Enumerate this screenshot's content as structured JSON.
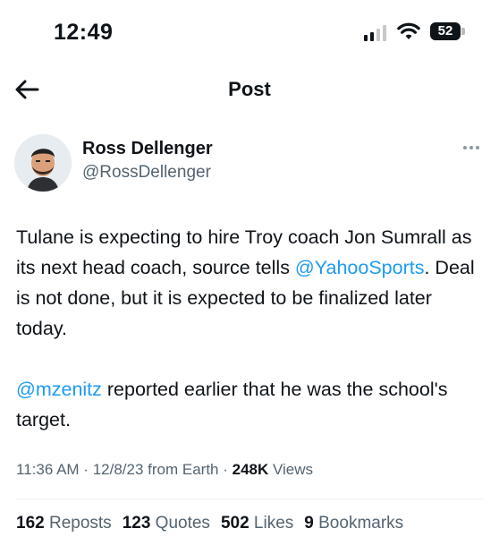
{
  "status_bar": {
    "time": "12:49",
    "battery_level": "52",
    "signal_bars": 4,
    "signal_active_bars": 2
  },
  "header": {
    "title": "Post",
    "back_icon": "arrow-left-icon"
  },
  "author": {
    "name": "Ross Dellenger",
    "handle": "@RossDellenger"
  },
  "tweet": {
    "line1_text": "Tulane is expecting to hire Troy coach Jon Sumrall as its next head coach, source tells ",
    "mention1": "@YahooSports",
    "line1_after": ". Deal is not done, but it is expected to be finalized later today.",
    "mention2": "@mzenitz",
    "line2_after": " reported earlier that he was the school's target."
  },
  "meta": {
    "time": "11:36 AM",
    "sep1": " · ",
    "date": "12/8/23",
    "source": " from Earth",
    "sep2": " · ",
    "views_count": "248K",
    "views_label": " Views"
  },
  "stats": {
    "reposts_count": "162",
    "reposts_label": " Reposts",
    "quotes_count": "123",
    "quotes_label": " Quotes",
    "likes_count": "502",
    "likes_label": " Likes",
    "bookmarks_count": "9",
    "bookmarks_label": " Bookmarks"
  },
  "colors": {
    "link": "#1d9bf0",
    "secondary_text": "#536471",
    "primary_text": "#0f1419"
  }
}
